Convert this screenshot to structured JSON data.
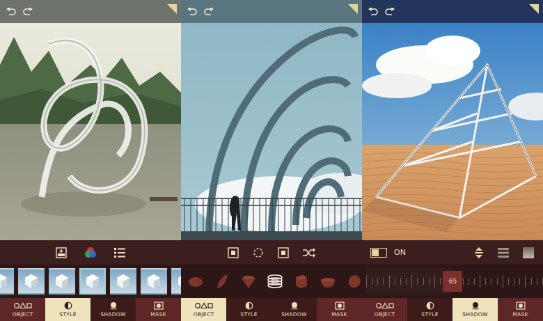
{
  "panels": [
    {
      "kind": "style",
      "thumbnails": [
        {
          "selected": false
        },
        {
          "selected": false
        },
        {
          "selected": false
        },
        {
          "selected": true
        },
        {
          "selected": false
        },
        {
          "selected": false
        },
        {
          "selected": false
        }
      ],
      "tabs": [
        {
          "label": "OBJECT",
          "selected": false
        },
        {
          "label": "STYLE",
          "selected": true
        },
        {
          "label": "SHADOW",
          "selected": false
        },
        {
          "label": "MASK",
          "selected": false
        }
      ]
    },
    {
      "kind": "object",
      "shapes": [
        {
          "selected": false
        },
        {
          "selected": false
        },
        {
          "selected": false
        },
        {
          "selected": true
        },
        {
          "selected": false
        },
        {
          "selected": false
        },
        {
          "selected": false
        }
      ],
      "tabs": [
        {
          "label": "OBJECT",
          "selected": true
        },
        {
          "label": "STYLE",
          "selected": false
        },
        {
          "label": "SHADOW",
          "selected": false
        },
        {
          "label": "MASK",
          "selected": false
        }
      ]
    },
    {
      "kind": "shadow",
      "toggle": {
        "label": "ON",
        "on": true
      },
      "slider": {
        "reading": "65",
        "level": 0.49
      },
      "tabs": [
        {
          "label": "OBJECT",
          "selected": false
        },
        {
          "label": "STYLE",
          "selected": false
        },
        {
          "label": "SHADOW",
          "selected": true
        },
        {
          "label": "MASK",
          "selected": false
        }
      ]
    }
  ]
}
